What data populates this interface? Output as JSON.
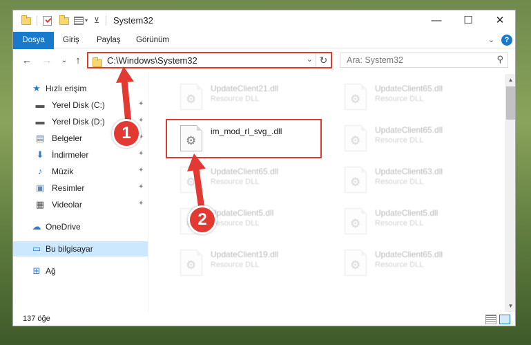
{
  "window": {
    "title": "System32",
    "controls": {
      "minimize": "—",
      "maximize": "☐",
      "close": "✕"
    }
  },
  "ribbon": {
    "tabs": [
      "Dosya",
      "Giriş",
      "Paylaş",
      "Görünüm"
    ],
    "expand": "⌄",
    "help": "?"
  },
  "navigation": {
    "back": "←",
    "forward": "→",
    "recent": "⌄",
    "up": "↑",
    "address": "C:\\Windows\\System32",
    "address_chevron": "⌄",
    "refresh": "↻",
    "search_placeholder": "Ara: System32",
    "search_icon": "⚲"
  },
  "sidebar": {
    "items": [
      {
        "label": "Hızlı erişim",
        "icon": "star-icon",
        "glyph": "★",
        "color": "#2e7ad1",
        "pinned": false
      },
      {
        "label": "Yerel Disk (C:)",
        "icon": "drive-icon",
        "glyph": "▬",
        "color": "#555555",
        "pinned": true
      },
      {
        "label": "Yerel Disk (D:)",
        "icon": "drive-icon",
        "glyph": "▬",
        "color": "#555555",
        "pinned": true
      },
      {
        "label": "Belgeler",
        "icon": "documents-icon",
        "glyph": "▤",
        "color": "#5f7fa7",
        "pinned": true
      },
      {
        "label": "İndirmeler",
        "icon": "downloads-icon",
        "glyph": "⬇",
        "color": "#2e7ad1",
        "pinned": true
      },
      {
        "label": "Müzik",
        "icon": "music-icon",
        "glyph": "♪",
        "color": "#2e7ad1",
        "pinned": true
      },
      {
        "label": "Resimler",
        "icon": "pictures-icon",
        "glyph": "▣",
        "color": "#5d8bb5",
        "pinned": true
      },
      {
        "label": "Videolar",
        "icon": "videos-icon",
        "glyph": "▦",
        "color": "#555555",
        "pinned": true
      },
      {
        "label": "OneDrive",
        "icon": "onedrive-icon",
        "glyph": "☁",
        "color": "#2e7ad1",
        "pinned": false
      },
      {
        "label": "Bu bilgisayar",
        "icon": "computer-icon",
        "glyph": "▭",
        "color": "#2e7ad1",
        "pinned": false,
        "selected": true
      },
      {
        "label": "Ağ",
        "icon": "network-icon",
        "glyph": "⊞",
        "color": "#2e7ad1",
        "pinned": false
      }
    ],
    "pin_glyph": "✦"
  },
  "files": [
    {
      "name": "UpdateClient21.dll",
      "type": "Resource DLL",
      "faded": true
    },
    {
      "name": "UpdateClient65.dll",
      "type": "Resource DLL",
      "faded": true
    },
    {
      "name": "im_mod_rl_svg_.dll",
      "type": "",
      "faded": false,
      "highlighted": true
    },
    {
      "name": "UpdateClient65.dll",
      "type": "Resource DLL",
      "faded": true
    },
    {
      "name": "UpdateClient65.dll",
      "type": "Resource DLL",
      "faded": true
    },
    {
      "name": "UpdateClient63.dll",
      "type": "Resource DLL",
      "faded": true
    },
    {
      "name": "UpdateClient5.dll",
      "type": "Resource DLL",
      "faded": true
    },
    {
      "name": "UpdateClient5.dll",
      "type": "Resource DLL",
      "faded": true
    },
    {
      "name": "UpdateClient19.dll",
      "type": "Resource DLL",
      "faded": true
    },
    {
      "name": "UpdateClient65.dll",
      "type": "Resource DLL",
      "faded": true
    }
  ],
  "status": {
    "count": "137 öğe"
  },
  "callouts": [
    "1",
    "2"
  ],
  "colors": {
    "accent": "#1979ca",
    "highlight": "#e23a33",
    "selection": "#cce8ff"
  }
}
